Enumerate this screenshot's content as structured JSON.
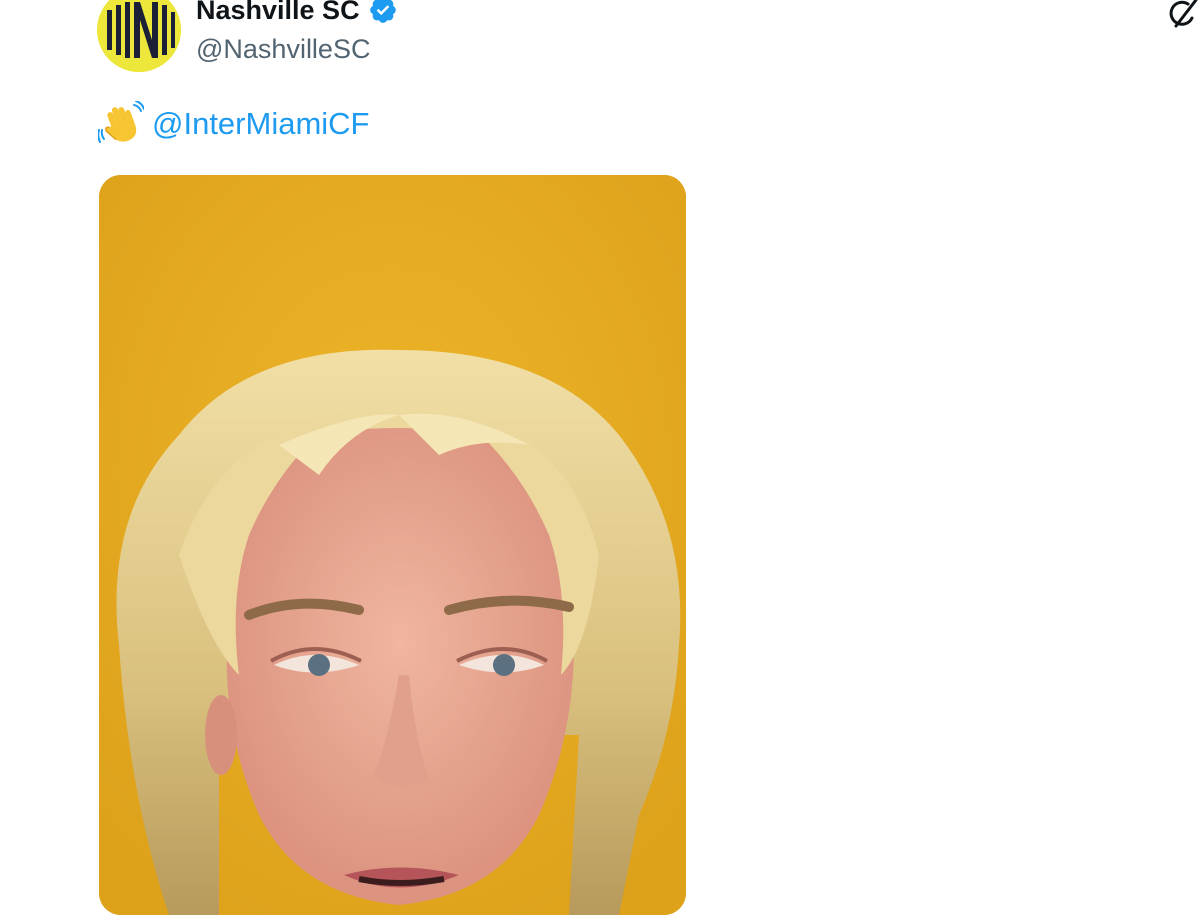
{
  "tweet": {
    "author": {
      "display_name": "Nashville SC",
      "handle": "@NashvilleSC",
      "verified": true,
      "avatar_icon": "nashville-sc-logo",
      "avatar_color": "#ece73a"
    },
    "text": {
      "emoji": "waving-hand",
      "mention": "@InterMiamiCF"
    },
    "media": {
      "type": "video",
      "background_color": "#e7ae22"
    },
    "colors": {
      "link": "#1d9bf0",
      "verified": "#1d9bf0",
      "handle": "#536471"
    }
  }
}
